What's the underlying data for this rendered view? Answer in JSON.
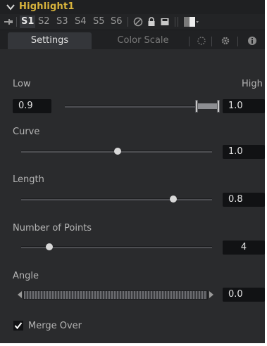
{
  "header": {
    "title": "Highlight1"
  },
  "versions": {
    "items": [
      "S1",
      "S2",
      "S3",
      "S4",
      "S5",
      "S6"
    ],
    "active": "S1"
  },
  "tabs": {
    "settings": "Settings",
    "color_scale": "Color Scale"
  },
  "controls": {
    "low_label": "Low",
    "high_label": "High",
    "low_value": "0.9",
    "high_value": "1.0",
    "curve_label": "Curve",
    "curve_value": "1.0",
    "length_label": "Length",
    "length_value": "0.8",
    "points_label": "Number of Points",
    "points_value": "4",
    "angle_label": "Angle",
    "angle_value": "0.0",
    "merge_label": "Merge Over",
    "merge_checked": true
  },
  "colors": {
    "accent_title": "#d9b43c",
    "panel_bg": "#2a2b2d",
    "value_bg": "#111214"
  },
  "icons": [
    "chevron-down-icon",
    "pin-icon",
    "disable-icon",
    "lock-icon",
    "save-icon",
    "color-swatch-icon",
    "dropdown-arrow-icon",
    "blend-icon",
    "gear-icon",
    "info-icon",
    "checkbox-icon"
  ]
}
